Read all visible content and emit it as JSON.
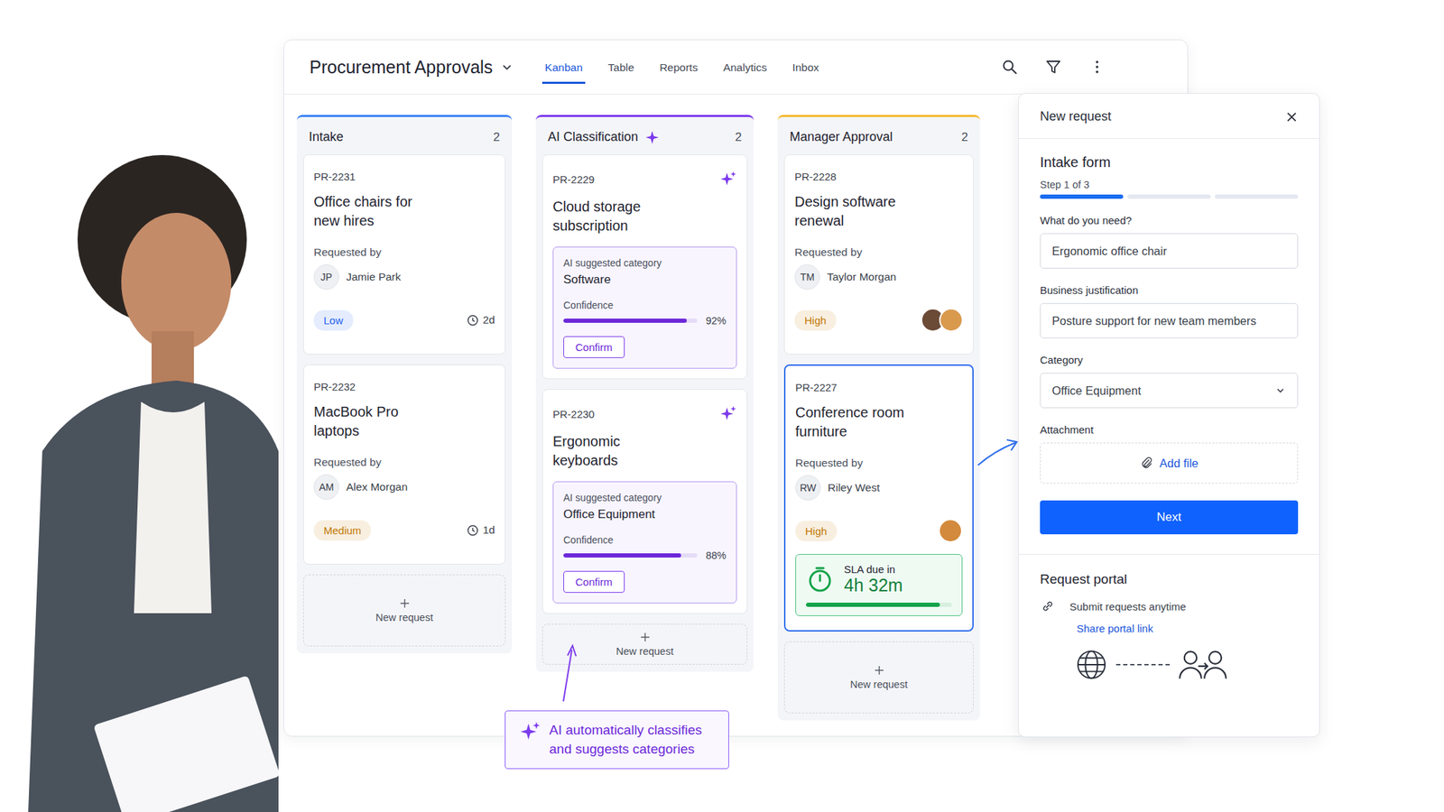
{
  "board": {
    "title": "Procurement Approvals",
    "tabs": [
      {
        "label": "Kanban",
        "selected": true
      },
      {
        "label": "Table",
        "selected": false
      },
      {
        "label": "Reports",
        "selected": false
      },
      {
        "label": "Analytics",
        "selected": false
      },
      {
        "label": "Inbox",
        "selected": false
      }
    ]
  },
  "columns": [
    {
      "title": "Intake",
      "count": "2",
      "color": "#3b82f6",
      "ai": false,
      "add_label": "New request",
      "cards": [
        {
          "kind": "request",
          "id": "PR-2231",
          "title": "Office chairs for new hires",
          "requested_label": "Requested by",
          "initials": "JP",
          "requester": "Jamie Park",
          "priority": "Low",
          "color": "#2563eb",
          "age": "2d",
          "assignees": 0,
          "selected": false
        },
        {
          "kind": "request",
          "id": "PR-2232",
          "title": "MacBook Pro laptops",
          "requested_label": "Requested by",
          "initials": "AM",
          "requester": "Alex Morgan",
          "priority": "Medium",
          "color": "#c27803",
          "age": "1d",
          "assignees": 0,
          "selected": false
        }
      ]
    },
    {
      "title": "AI Classification",
      "count": "2",
      "color": "#7c3aed",
      "ai": true,
      "add_label": "New request",
      "cards": [
        {
          "kind": "ai",
          "id": "PR-2229",
          "title": "Cloud storage subscription",
          "selected": false,
          "suggestion": {
            "label": "AI suggested category",
            "category": "Software",
            "confidence_label": "Confidence",
            "level": 0.92,
            "reading": "92%",
            "action": "Confirm"
          }
        },
        {
          "kind": "ai",
          "id": "PR-2230",
          "title": "Ergonomic keyboards",
          "selected": false,
          "suggestion": {
            "label": "AI suggested category",
            "category": "Office Equipment",
            "confidence_label": "Confidence",
            "level": 0.88,
            "reading": "88%",
            "action": "Confirm"
          }
        }
      ]
    },
    {
      "title": "Manager Approval",
      "count": "2",
      "color": "#f5b82e",
      "ai": false,
      "add_label": "New request",
      "cards": [
        {
          "kind": "request",
          "id": "PR-2228",
          "title": "Design software renewal",
          "requested_label": "Requested by",
          "initials": "TM",
          "requester": "Taylor Morgan",
          "priority": "High",
          "color": "#c27803",
          "age": "",
          "assignees": 2,
          "selected": false
        },
        {
          "kind": "request",
          "id": "PR-2227",
          "title": "Conference room furniture",
          "requested_label": "Requested by",
          "initials": "RW",
          "requester": "Riley West",
          "priority": "High",
          "color": "#c27803",
          "age": "",
          "assignees": 1,
          "selected": true,
          "sla": {
            "label": "SLA due in",
            "value": "4h 32m",
            "level": 0.92
          }
        }
      ]
    }
  ],
  "panel": {
    "title": "New request",
    "form_title": "Intake form",
    "step": "Step 1 of 3",
    "steps": [
      {
        "done": true
      },
      {
        "done": false
      },
      {
        "done": false
      }
    ],
    "fields": [
      {
        "kind": "input",
        "label": "What do you need?",
        "value": "Ergonomic office chair"
      },
      {
        "kind": "input",
        "label": "Business justification",
        "value": "Posture support for new team members"
      },
      {
        "kind": "select",
        "label": "Category",
        "value": "Office Equipment"
      },
      {
        "kind": "file",
        "label": "Attachment",
        "value": "Add file"
      }
    ],
    "submit": "Next",
    "portal": {
      "title": "Request portal",
      "text": "Submit requests anytime",
      "link": "Share portal link"
    }
  },
  "callout": {
    "text": "AI automatically classifies and suggests categories"
  }
}
